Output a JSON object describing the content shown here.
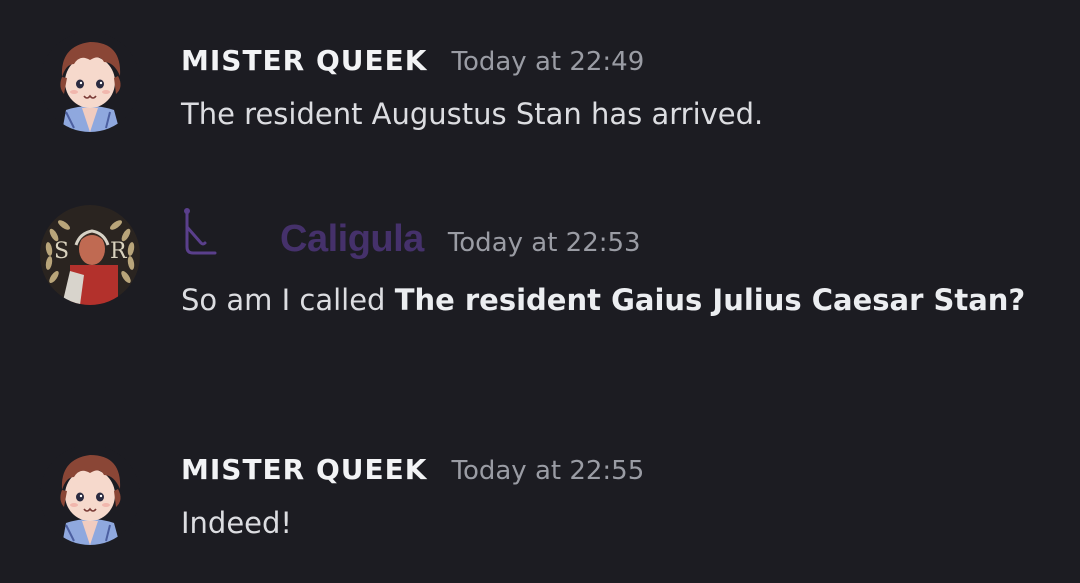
{
  "messages": [
    {
      "username": "MISTER QUEEK",
      "timestamp": "Today at 22:49",
      "text": "The resident Augustus Stan has arrived.",
      "avatar_icon": "cartoon-boy-avatar"
    },
    {
      "username": "Caligula",
      "timestamp": "Today at 22:53",
      "text_plain": "So am I called ",
      "text_bold": "The resident Gaius Julius Caesar Stan?",
      "avatar_icon": "spqr-laurel-avatar",
      "avatar_letters_left": "S",
      "avatar_letters_right": "R",
      "role_icon": "bot-tag-icon",
      "name_color": "#45316b"
    },
    {
      "username": "MISTER QUEEK",
      "timestamp": "Today at 22:55",
      "text": "Indeed!",
      "avatar_icon": "cartoon-boy-avatar"
    }
  ]
}
